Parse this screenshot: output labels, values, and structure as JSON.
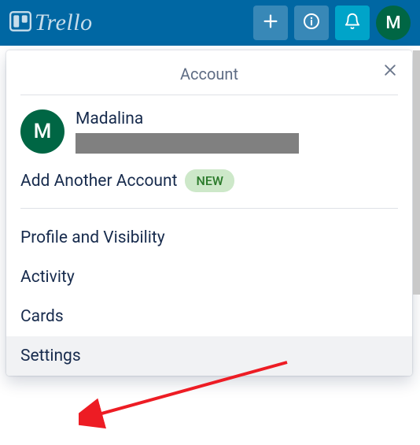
{
  "topbar": {
    "logo_text": "Trello",
    "avatar_initial": "M"
  },
  "panel": {
    "title": "Account",
    "user": {
      "name": "Madalina",
      "avatar_initial": "M"
    },
    "add_account": {
      "label": "Add Another Account",
      "badge": "NEW"
    },
    "menu": {
      "profile": "Profile and Visibility",
      "activity": "Activity",
      "cards": "Cards",
      "settings": "Settings"
    }
  }
}
